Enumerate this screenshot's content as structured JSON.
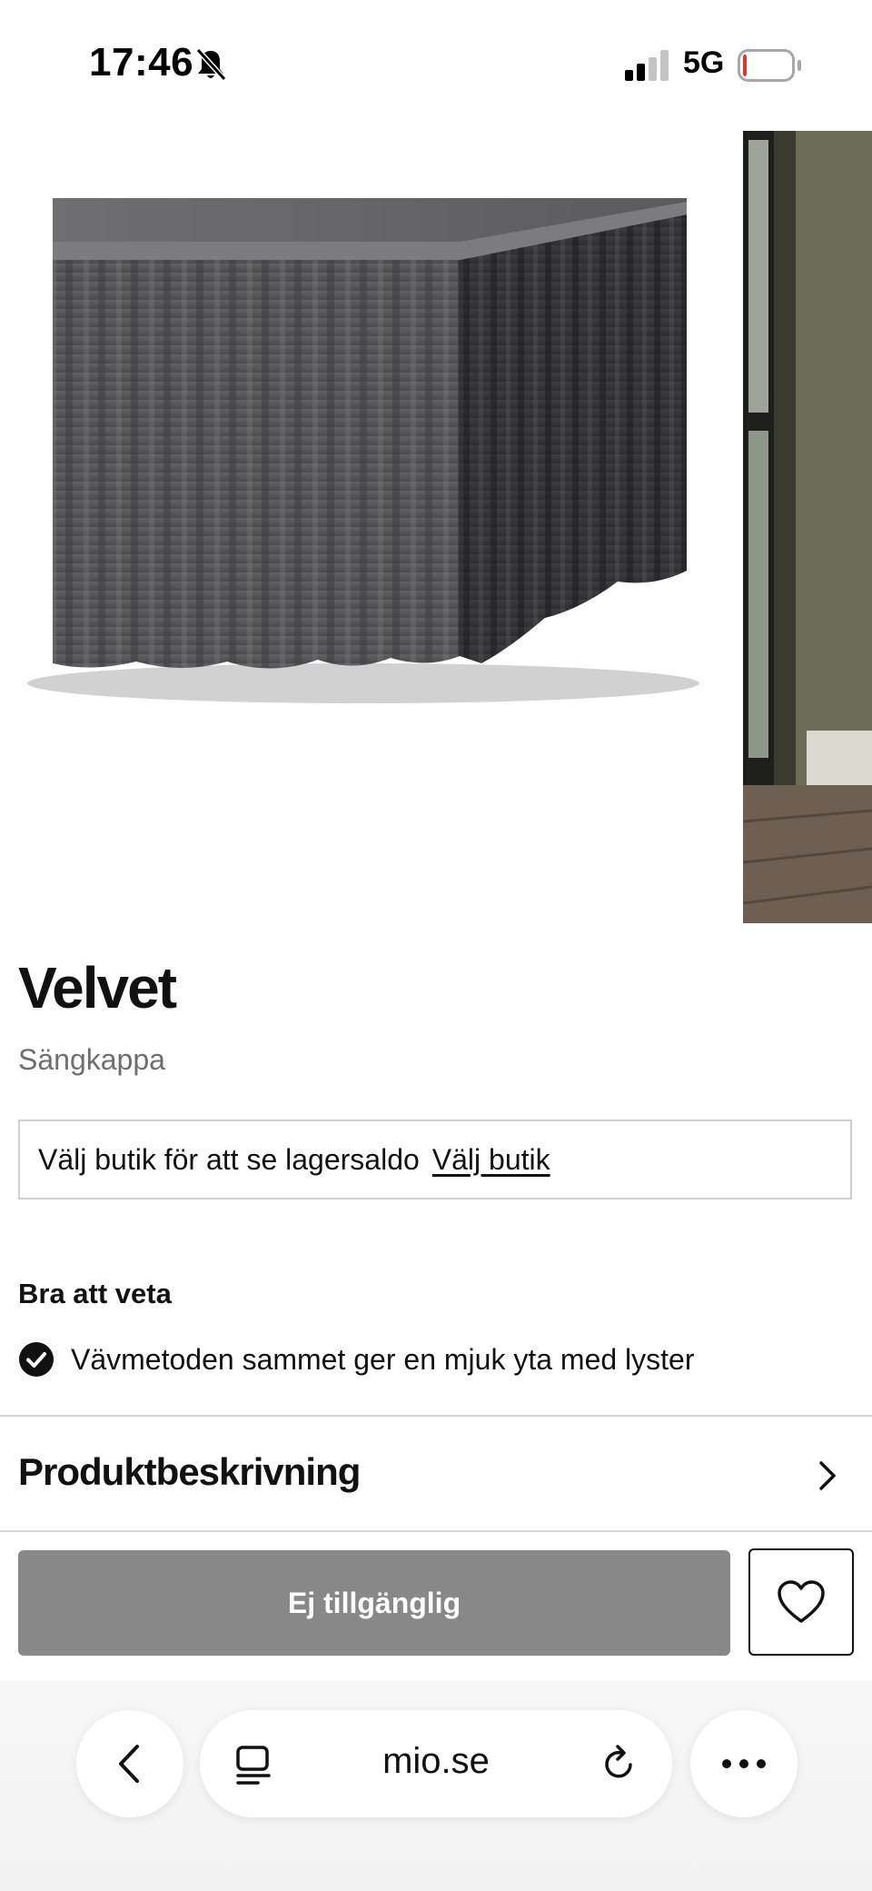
{
  "status_bar": {
    "time": "17:46",
    "network": "5G",
    "icons": [
      "bell-slash-icon",
      "signal-icon",
      "battery-low-icon"
    ],
    "battery_level": 0.08
  },
  "gallery": {
    "main_image": "grey-velvet-bed-skirt",
    "side_image": "bedroom-window-floor"
  },
  "product": {
    "title": "Velvet",
    "subtitle": "Sängkappa"
  },
  "store": {
    "text": "Välj butik för att se lagersaldo",
    "link": "Välj butik"
  },
  "good_to_know": {
    "heading": "Bra att veta",
    "features": [
      {
        "icon": "check-circle-icon",
        "text": "Vävmetoden sammet ger en mjuk yta med lyster"
      }
    ]
  },
  "description": {
    "label": "Produktbeskrivning",
    "icon": "chevron-right-icon"
  },
  "actions": {
    "unavailable_label": "Ej tillgänglig",
    "wishlist_icon": "heart-icon"
  },
  "browser": {
    "url": "mio.se",
    "icons": [
      "back-icon",
      "reader-icon",
      "reload-icon",
      "more-icon"
    ]
  },
  "colors": {
    "button_disabled": "#888888",
    "text": "#111111",
    "muted_text": "#6e6e6e",
    "border": "#cfcfcf",
    "battery_red": "#e5352b"
  }
}
